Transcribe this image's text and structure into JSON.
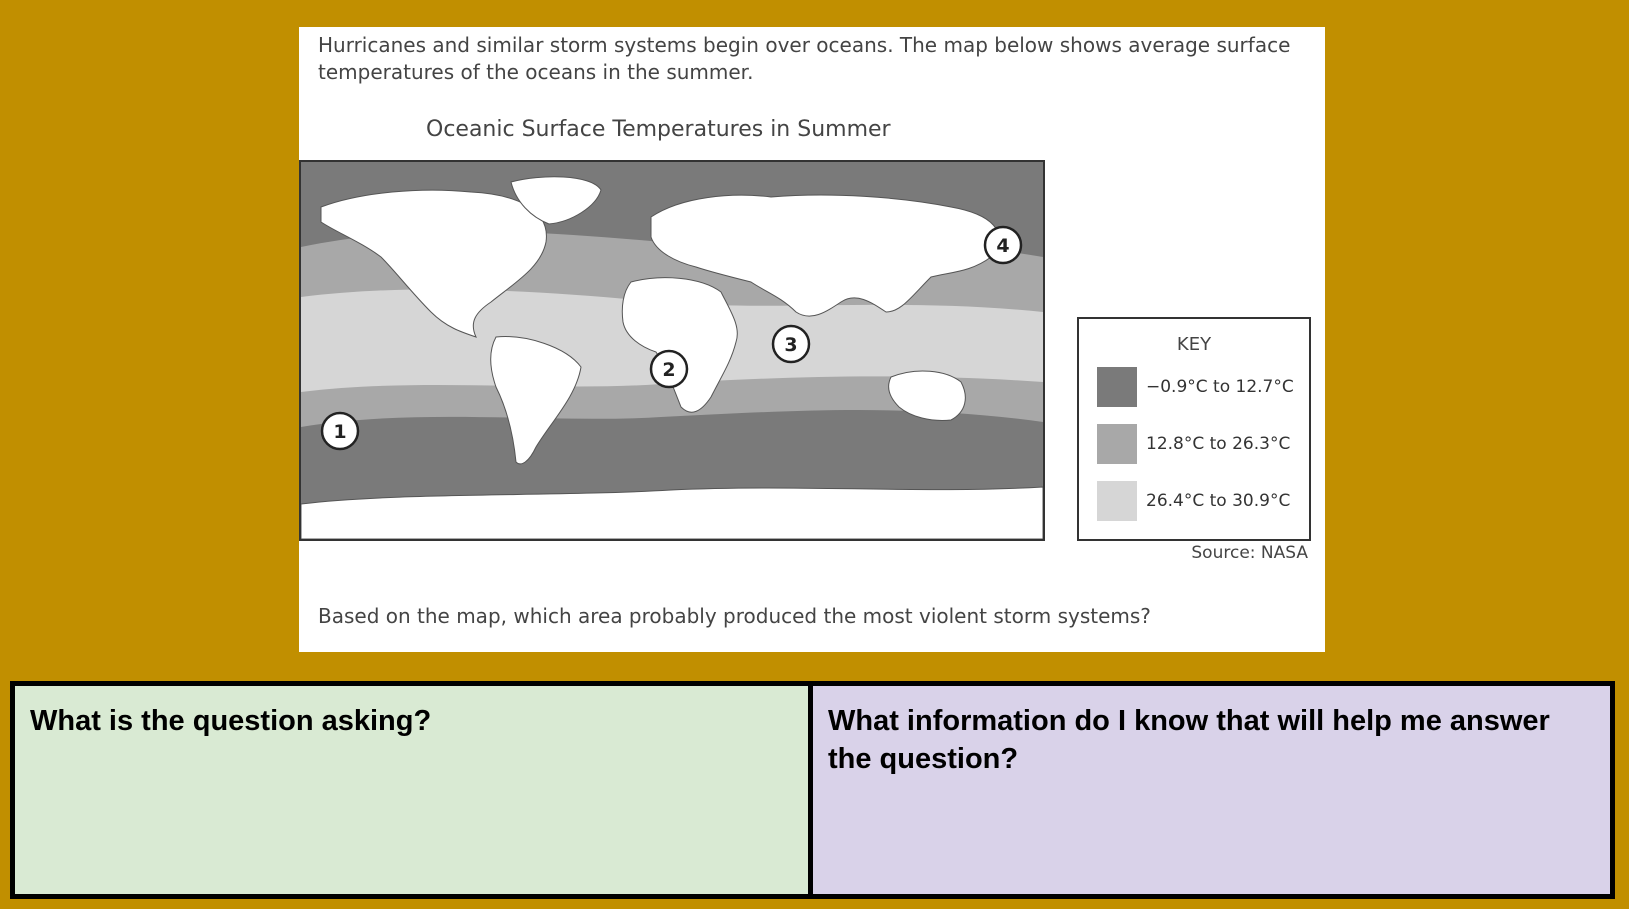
{
  "card": {
    "intro": "Hurricanes and similar storm systems begin over oceans. The map below shows average surface temperatures of the oceans in the summer.",
    "map_title": "Oceanic Surface Temperatures in Summer",
    "markers": [
      "1",
      "2",
      "3",
      "4"
    ],
    "key": {
      "title": "KEY",
      "entries": [
        {
          "label": "−0.9°C to 12.7°C",
          "color": "#7a7a7a"
        },
        {
          "label": "12.8°C to 26.3°C",
          "color": "#a8a8a8"
        },
        {
          "label": "26.4°C to 30.9°C",
          "color": "#d6d6d6"
        }
      ]
    },
    "source": "Source: NASA",
    "question": "Based on the map, which area probably produced the most violent storm systems?"
  },
  "table": {
    "left_prompt": "What is the question asking?",
    "right_prompt": "What information do I know that will help me answer the question?"
  },
  "colors": {
    "background": "#c18f00",
    "left_cell": "#d9ead3",
    "right_cell": "#d9d2e9"
  }
}
